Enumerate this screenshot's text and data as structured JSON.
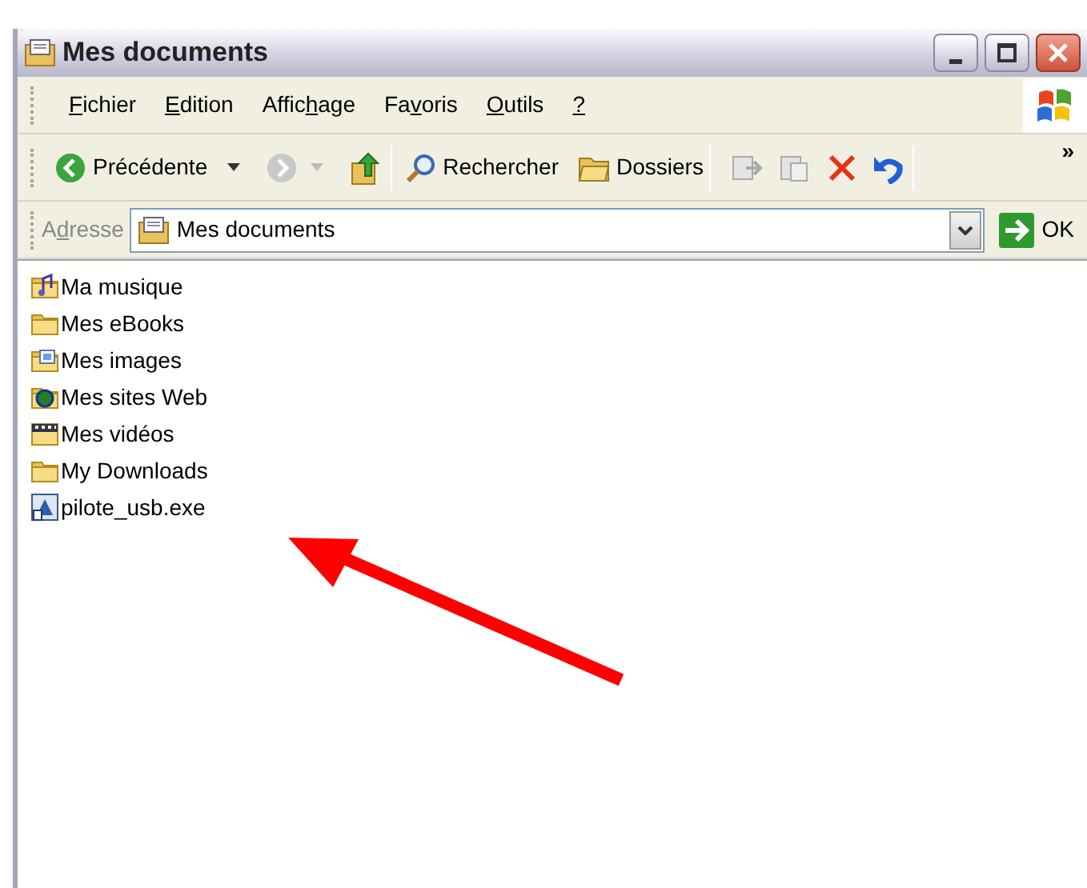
{
  "window": {
    "title": "Mes documents"
  },
  "menu": [
    {
      "key": "F",
      "after": "ichier"
    },
    {
      "key": "E",
      "after": "dition"
    },
    {
      "before": "Affic",
      "key": "h",
      "after": "age"
    },
    {
      "before": "Fa",
      "key": "v",
      "after": "oris"
    },
    {
      "key": "O",
      "after": "utils"
    },
    {
      "key": "?"
    }
  ],
  "toolbar": {
    "back": {
      "label": "Précédente"
    },
    "forward": {
      "disabled": true
    },
    "search": {
      "label": "Rechercher"
    },
    "folders": {
      "label": "Dossiers"
    },
    "more": "»"
  },
  "address": {
    "label": {
      "before": "A",
      "key": "d",
      "after": "resse"
    },
    "value": "Mes documents",
    "go": "OK"
  },
  "files": [
    {
      "name": "Ma musique",
      "kind": "music"
    },
    {
      "name": "Mes eBooks",
      "kind": "folder"
    },
    {
      "name": "Mes images",
      "kind": "images"
    },
    {
      "name": "Mes sites Web",
      "kind": "web"
    },
    {
      "name": "Mes vidéos",
      "kind": "video"
    },
    {
      "name": "My Downloads",
      "kind": "folder"
    },
    {
      "name": "pilote_usb.exe",
      "kind": "exe"
    }
  ]
}
